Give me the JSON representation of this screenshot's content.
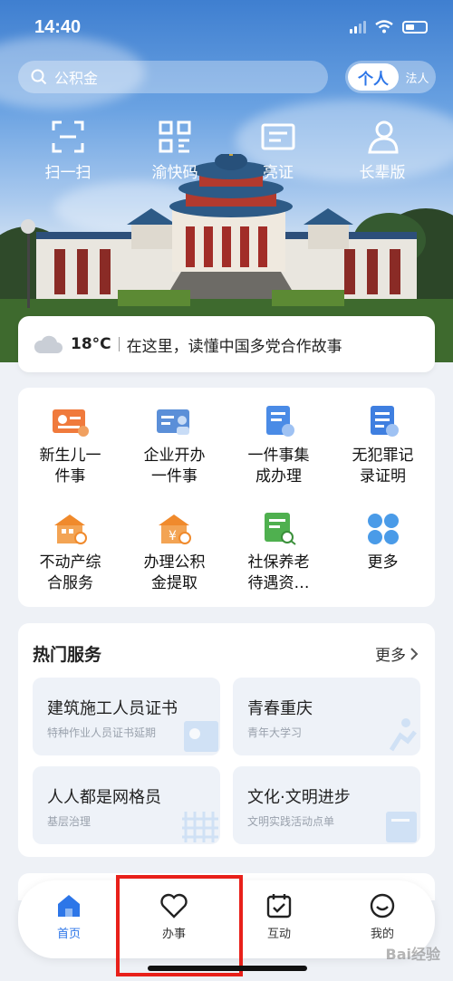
{
  "status_bar": {
    "time": "14:40"
  },
  "search": {
    "placeholder": "公积金"
  },
  "account_toggle": {
    "personal": "个人",
    "legal": "法人"
  },
  "quick_actions": [
    {
      "label": "扫一扫",
      "icon": "scan-icon"
    },
    {
      "label": "渝快码",
      "icon": "qr-code-icon"
    },
    {
      "label": "亮证",
      "icon": "id-card-icon"
    },
    {
      "label": "长辈版",
      "icon": "elder-person-icon"
    }
  ],
  "weather": {
    "temperature": "18°C",
    "message": "在这里，读懂中国多党合作故事",
    "icon": "cloud-icon"
  },
  "services": [
    {
      "line1": "新生儿一",
      "line2": "件事",
      "icon": "newborn-card-icon",
      "color": "#f07a3c"
    },
    {
      "line1": "企业开办",
      "line2": "一件事",
      "icon": "enterprise-card-icon",
      "color": "#5b8fd8"
    },
    {
      "line1": "一件事集",
      "line2": "成办理",
      "icon": "integrated-doc-icon",
      "color": "#4a8be6"
    },
    {
      "line1": "无犯罪记",
      "line2": "录证明",
      "icon": "certificate-icon",
      "color": "#3f7fe0"
    },
    {
      "line1": "不动产综",
      "line2": "合服务",
      "icon": "real-estate-icon",
      "color": "#f08a2c"
    },
    {
      "line1": "办理公积",
      "line2": "金提取",
      "icon": "fund-house-icon",
      "color": "#f08a2c"
    },
    {
      "line1": "社保养老",
      "line2": "待遇资…",
      "icon": "social-security-icon",
      "color": "#4fb04f"
    },
    {
      "line1": "更多",
      "line2": "",
      "icon": "more-grid-icon",
      "color": "#4a9be8"
    }
  ],
  "hot_services": {
    "title": "热门服务",
    "more": "更多",
    "cards": [
      {
        "title": "建筑施工人员证书",
        "subtitle": "特种作业人员证书延期"
      },
      {
        "title": "青春重庆",
        "subtitle": "青年大学习"
      },
      {
        "title": "人人都是网格员",
        "subtitle": "基层治理"
      },
      {
        "title": "文化·文明进步",
        "subtitle": "文明实践活动点单"
      }
    ]
  },
  "tab_bar": [
    {
      "label": "首页",
      "icon": "home-icon",
      "active": true
    },
    {
      "label": "办事",
      "icon": "heart-icon",
      "active": false
    },
    {
      "label": "互动",
      "icon": "calendar-check-icon",
      "active": false
    },
    {
      "label": "我的",
      "icon": "smiley-icon",
      "active": false
    }
  ],
  "watermark": "Bai经验"
}
